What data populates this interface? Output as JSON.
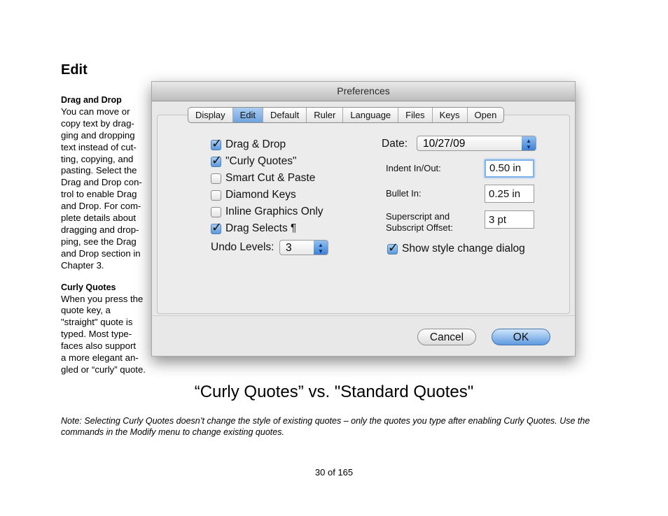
{
  "page": {
    "section_title": "Edit",
    "caption": "“Curly Quotes” vs. \"Standard Quotes\"",
    "note": "Note: Selecting Curly Quotes doesn’t change the style of existing quotes – only the quotes you type after enabling Curly Quotes. Use the commands in the Modify menu to change existing quotes.",
    "page_number": "30 of 165"
  },
  "sidebar": {
    "drag_title": "Drag and Drop",
    "drag_lines": [
      "You can move or",
      "copy text by drag-",
      "ging and dropping",
      "text instead of cut-",
      "ting, copying, and",
      "pasting. Select the",
      "Drag and Drop con-",
      "trol to enable Drag",
      "and Drop. For com-",
      "plete details about",
      "dragging and drop-",
      "ping, see the Drag",
      "and Drop section in",
      "Chapter 3."
    ],
    "curly_title": "Curly Quotes",
    "curly_lines": [
      "When you press the",
      "quote key, a",
      "\"straight\" quote is",
      "typed. Most type-",
      "faces also support",
      "a more elegant an-",
      "gled or “curly” quote."
    ]
  },
  "dialog": {
    "title": "Preferences",
    "tabs": [
      "Display",
      "Edit",
      "Default",
      "Ruler",
      "Language",
      "Files",
      "Keys",
      "Open"
    ],
    "active_tab": "Edit",
    "checkboxes": [
      {
        "label": "Drag & Drop",
        "checked": true
      },
      {
        "label": "\"Curly Quotes\"",
        "checked": true
      },
      {
        "label": "Smart Cut & Paste",
        "checked": false
      },
      {
        "label": "Diamond Keys",
        "checked": false
      },
      {
        "label": "Inline Graphics Only",
        "checked": false
      },
      {
        "label": "Drag Selects ¶",
        "checked": true
      }
    ],
    "undo_label": "Undo Levels:",
    "undo_value": "3",
    "date_label": "Date:",
    "date_value": "10/27/09",
    "indent_label": "Indent In/Out:",
    "indent_value": "0.50 in",
    "bullet_label": "Bullet In:",
    "bullet_value": "0.25 in",
    "superscript_label_1": "Superscript and",
    "superscript_label_2": "Subscript Offset:",
    "superscript_value": "3 pt",
    "show_style_label": "Show style change dialog",
    "show_style_checked": true,
    "cancel_label": "Cancel",
    "ok_label": "OK",
    "colors": {
      "accent": "#5e97d8",
      "tab_active": "#6ea3de"
    }
  }
}
